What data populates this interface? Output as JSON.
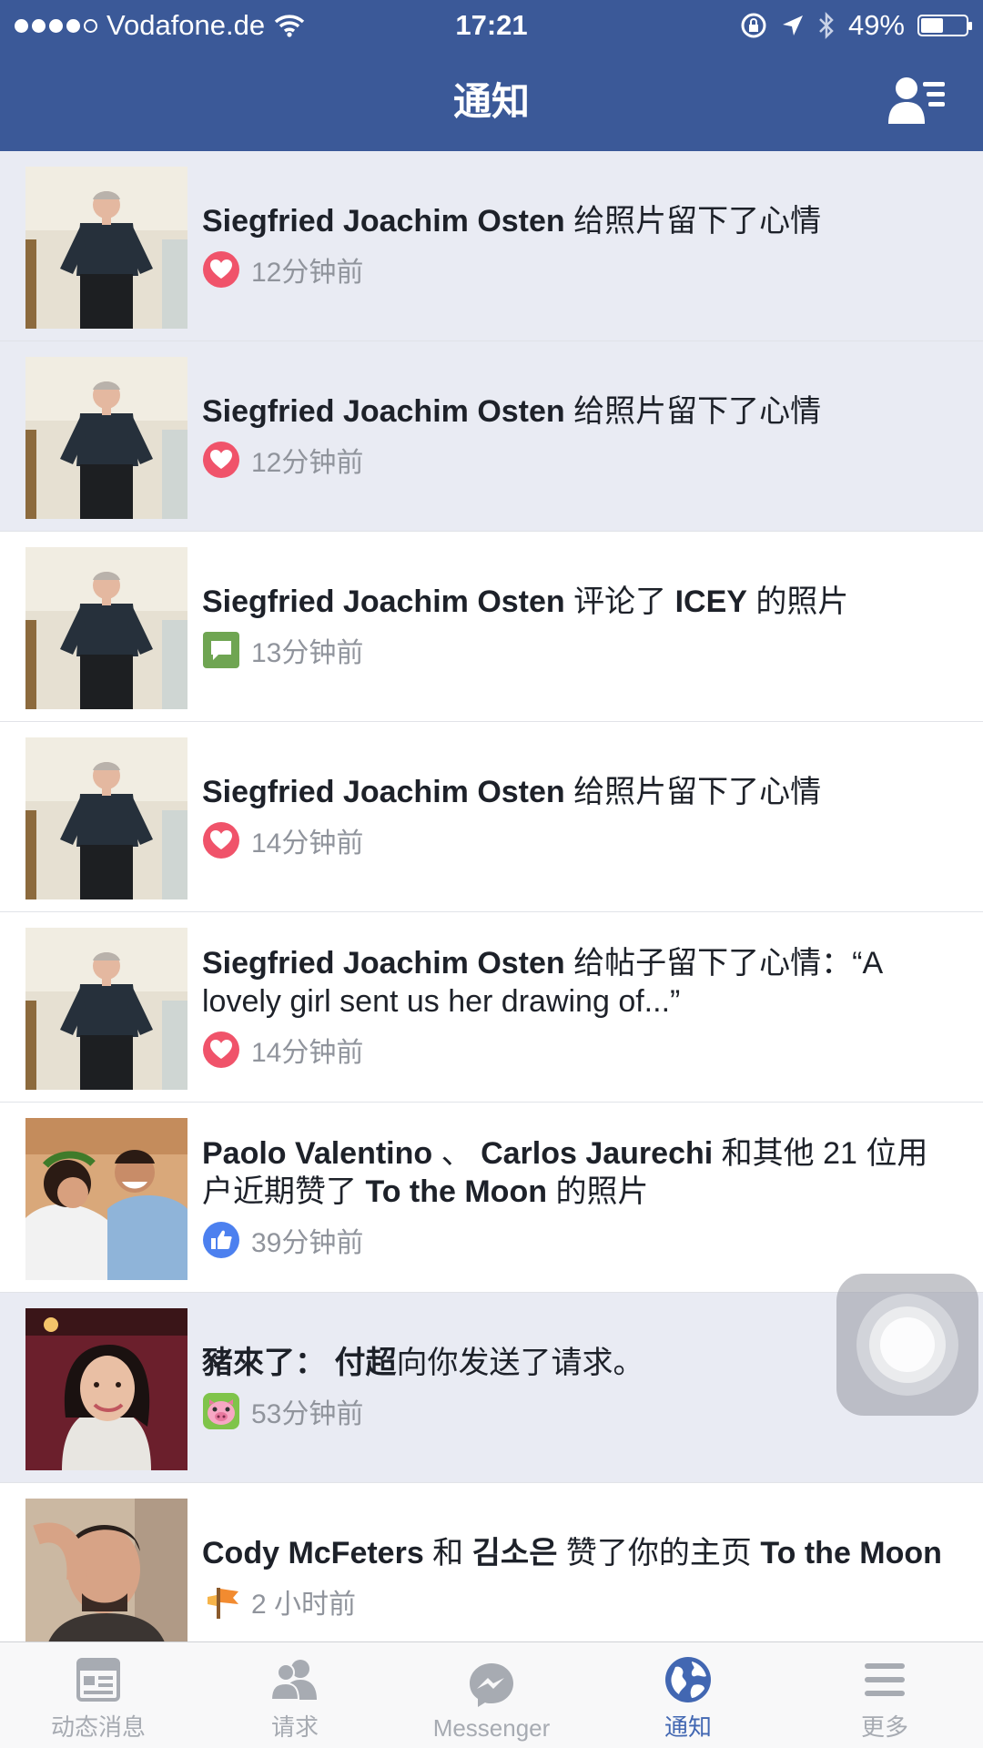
{
  "status_bar": {
    "carrier": "Vodafone.de",
    "time": "17:21",
    "battery": "49%",
    "battery_level": 0.49,
    "signal_bars": 4
  },
  "header": {
    "title": "通知"
  },
  "notifications": [
    {
      "segments": [
        {
          "text": "Siegfried Joachim Osten",
          "bold": true
        },
        {
          "text": " 给照片留下了心情",
          "bold": false
        }
      ],
      "time": "12分钟前",
      "icon": "heart-icon",
      "unread": true,
      "avatar": "man-photo"
    },
    {
      "segments": [
        {
          "text": "Siegfried Joachim Osten",
          "bold": true
        },
        {
          "text": " 给照片留下了心情",
          "bold": false
        }
      ],
      "time": "12分钟前",
      "icon": "heart-icon",
      "unread": true,
      "avatar": "man-photo"
    },
    {
      "segments": [
        {
          "text": "Siegfried Joachim Osten",
          "bold": true
        },
        {
          "text": " 评论了 ",
          "bold": false
        },
        {
          "text": "ICEY",
          "bold": true
        },
        {
          "text": " 的照片",
          "bold": false
        }
      ],
      "time": "13分钟前",
      "icon": "comment-icon",
      "unread": false,
      "avatar": "man-photo"
    },
    {
      "segments": [
        {
          "text": "Siegfried Joachim Osten",
          "bold": true
        },
        {
          "text": " 给照片留下了心情",
          "bold": false
        }
      ],
      "time": "14分钟前",
      "icon": "heart-icon",
      "unread": false,
      "avatar": "man-photo"
    },
    {
      "segments": [
        {
          "text": "Siegfried Joachim Osten",
          "bold": true
        },
        {
          "text": " 给帖子留下了心情：“A lovely girl sent us her drawing of...”",
          "bold": false
        }
      ],
      "time": "14分钟前",
      "icon": "heart-icon",
      "unread": false,
      "avatar": "man-photo"
    },
    {
      "segments": [
        {
          "text": "Paolo Valentino",
          "bold": true
        },
        {
          "text": " 、 ",
          "bold": false
        },
        {
          "text": "Carlos Jaurechi",
          "bold": true
        },
        {
          "text": " 和其他 21 位用户近期赞了 ",
          "bold": false
        },
        {
          "text": "To the Moon",
          "bold": true
        },
        {
          "text": " 的照片",
          "bold": false
        }
      ],
      "time": "39分钟前",
      "icon": "like-icon",
      "unread": false,
      "avatar": "couple-photo"
    },
    {
      "segments": [
        {
          "text": "豬來了：",
          "bold": true
        },
        {
          "text": " ",
          "bold": false
        },
        {
          "text": "付超",
          "bold": true
        },
        {
          "text": "向你发送了请求。",
          "bold": false
        }
      ],
      "time": "53分钟前",
      "icon": "game-app-icon",
      "unread": true,
      "avatar": "woman-photo"
    },
    {
      "segments": [
        {
          "text": "Cody McFeters",
          "bold": true
        },
        {
          "text": " 和 ",
          "bold": false
        },
        {
          "text": "김소은",
          "bold": true
        },
        {
          "text": " 赞了你的主页 ",
          "bold": false
        },
        {
          "text": "To the Moon",
          "bold": true
        }
      ],
      "time": "2 小时前",
      "icon": "page-flag-icon",
      "unread": false,
      "avatar": "man2-photo"
    }
  ],
  "tabbar": {
    "items": [
      {
        "label": "动态消息",
        "icon": "news-feed-icon",
        "active": false
      },
      {
        "label": "请求",
        "icon": "friend-requests-icon",
        "active": false
      },
      {
        "label": "Messenger",
        "icon": "messenger-icon",
        "active": false
      },
      {
        "label": "通知",
        "icon": "notifications-globe-icon",
        "active": true
      },
      {
        "label": "更多",
        "icon": "menu-icon",
        "active": false
      }
    ]
  },
  "colors": {
    "brand": "#3b5998",
    "unread_bg": "#e9ebf3",
    "heart": "#f0536a",
    "comment": "#6fa552",
    "like": "#4c80ef",
    "active_tab": "#4267b2"
  }
}
